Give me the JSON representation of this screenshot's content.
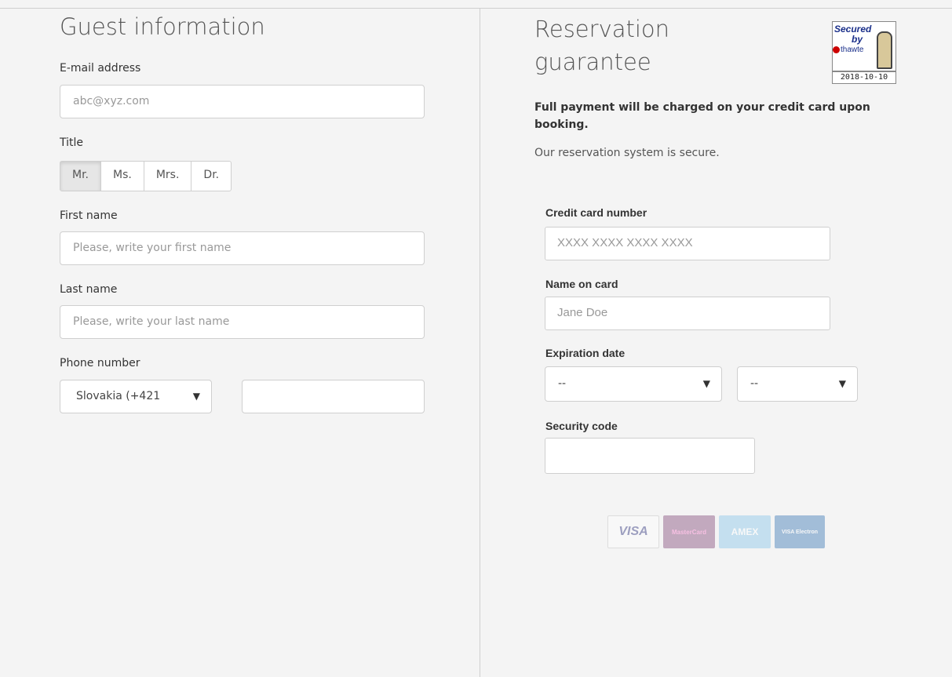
{
  "guest": {
    "heading": "Guest information",
    "email_label": "E-mail address",
    "email_placeholder": "abc@xyz.com",
    "title_label": "Title",
    "titles": [
      "Mr.",
      "Ms.",
      "Mrs.",
      "Dr."
    ],
    "title_selected": "Mr.",
    "first_name_label": "First name",
    "first_name_placeholder": "Please, write your first name",
    "last_name_label": "Last name",
    "last_name_placeholder": "Please, write your last name",
    "phone_label": "Phone number",
    "phone_country": "Slovakia (+421",
    "phone_number": ""
  },
  "guarantee": {
    "heading": "Reservation guarantee",
    "note_bold": "Full payment will be charged on your credit card upon booking.",
    "note": "Our reservation system is secure.",
    "seal": {
      "line1": "Secured",
      "line2": "by",
      "brand": "thawte",
      "date": "2018-10-10"
    },
    "cc_label": "Credit card number",
    "cc_placeholder": "XXXX XXXX XXXX XXXX",
    "name_label": "Name on card",
    "name_placeholder": "Jane Doe",
    "exp_label": "Expiration date",
    "exp_month": "--",
    "exp_year": "--",
    "cvc_label": "Security code",
    "cvc_value": "",
    "cards": [
      "VISA",
      "MasterCard",
      "AMEX",
      "VISA Electron"
    ]
  }
}
